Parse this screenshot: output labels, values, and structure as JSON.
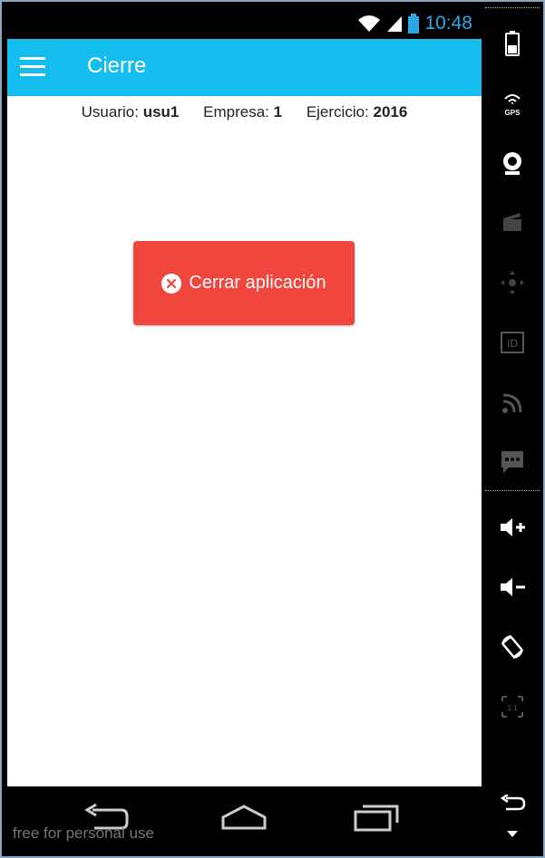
{
  "status_bar": {
    "time": "10:48"
  },
  "app_bar": {
    "title": "Cierre"
  },
  "info": {
    "user_label": "Usuario:",
    "user_value": "usu1",
    "company_label": "Empresa:",
    "company_value": "1",
    "year_label": "Ejercicio:",
    "year_value": "2016"
  },
  "close_button": {
    "label": "Cerrar aplicación",
    "color": "#f0463d"
  },
  "accent_color": "#14bdee",
  "watermark": "free for personal use",
  "side_panel": {
    "gps_label": "GPS",
    "id_label": "ID",
    "icons": [
      "battery-icon",
      "gps-icon",
      "webcam-icon",
      "camera-icon",
      "dpad-icon",
      "id-icon",
      "rss-icon",
      "sms-icon",
      "volume-up-icon",
      "volume-down-icon",
      "rotate-icon",
      "scale-icon",
      "back-icon",
      "menu-icon"
    ]
  }
}
